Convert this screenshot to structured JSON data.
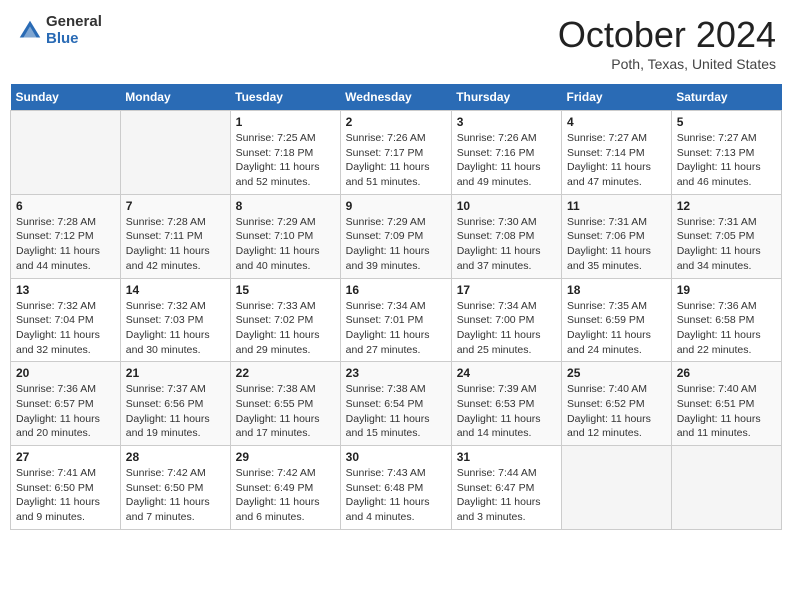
{
  "header": {
    "logo_general": "General",
    "logo_blue": "Blue",
    "month_title": "October 2024",
    "location": "Poth, Texas, United States"
  },
  "days_of_week": [
    "Sunday",
    "Monday",
    "Tuesday",
    "Wednesday",
    "Thursday",
    "Friday",
    "Saturday"
  ],
  "weeks": [
    [
      {
        "day": "",
        "empty": true
      },
      {
        "day": "",
        "empty": true
      },
      {
        "day": "1",
        "sunrise": "Sunrise: 7:25 AM",
        "sunset": "Sunset: 7:18 PM",
        "daylight": "Daylight: 11 hours and 52 minutes."
      },
      {
        "day": "2",
        "sunrise": "Sunrise: 7:26 AM",
        "sunset": "Sunset: 7:17 PM",
        "daylight": "Daylight: 11 hours and 51 minutes."
      },
      {
        "day": "3",
        "sunrise": "Sunrise: 7:26 AM",
        "sunset": "Sunset: 7:16 PM",
        "daylight": "Daylight: 11 hours and 49 minutes."
      },
      {
        "day": "4",
        "sunrise": "Sunrise: 7:27 AM",
        "sunset": "Sunset: 7:14 PM",
        "daylight": "Daylight: 11 hours and 47 minutes."
      },
      {
        "day": "5",
        "sunrise": "Sunrise: 7:27 AM",
        "sunset": "Sunset: 7:13 PM",
        "daylight": "Daylight: 11 hours and 46 minutes."
      }
    ],
    [
      {
        "day": "6",
        "sunrise": "Sunrise: 7:28 AM",
        "sunset": "Sunset: 7:12 PM",
        "daylight": "Daylight: 11 hours and 44 minutes."
      },
      {
        "day": "7",
        "sunrise": "Sunrise: 7:28 AM",
        "sunset": "Sunset: 7:11 PM",
        "daylight": "Daylight: 11 hours and 42 minutes."
      },
      {
        "day": "8",
        "sunrise": "Sunrise: 7:29 AM",
        "sunset": "Sunset: 7:10 PM",
        "daylight": "Daylight: 11 hours and 40 minutes."
      },
      {
        "day": "9",
        "sunrise": "Sunrise: 7:29 AM",
        "sunset": "Sunset: 7:09 PM",
        "daylight": "Daylight: 11 hours and 39 minutes."
      },
      {
        "day": "10",
        "sunrise": "Sunrise: 7:30 AM",
        "sunset": "Sunset: 7:08 PM",
        "daylight": "Daylight: 11 hours and 37 minutes."
      },
      {
        "day": "11",
        "sunrise": "Sunrise: 7:31 AM",
        "sunset": "Sunset: 7:06 PM",
        "daylight": "Daylight: 11 hours and 35 minutes."
      },
      {
        "day": "12",
        "sunrise": "Sunrise: 7:31 AM",
        "sunset": "Sunset: 7:05 PM",
        "daylight": "Daylight: 11 hours and 34 minutes."
      }
    ],
    [
      {
        "day": "13",
        "sunrise": "Sunrise: 7:32 AM",
        "sunset": "Sunset: 7:04 PM",
        "daylight": "Daylight: 11 hours and 32 minutes."
      },
      {
        "day": "14",
        "sunrise": "Sunrise: 7:32 AM",
        "sunset": "Sunset: 7:03 PM",
        "daylight": "Daylight: 11 hours and 30 minutes."
      },
      {
        "day": "15",
        "sunrise": "Sunrise: 7:33 AM",
        "sunset": "Sunset: 7:02 PM",
        "daylight": "Daylight: 11 hours and 29 minutes."
      },
      {
        "day": "16",
        "sunrise": "Sunrise: 7:34 AM",
        "sunset": "Sunset: 7:01 PM",
        "daylight": "Daylight: 11 hours and 27 minutes."
      },
      {
        "day": "17",
        "sunrise": "Sunrise: 7:34 AM",
        "sunset": "Sunset: 7:00 PM",
        "daylight": "Daylight: 11 hours and 25 minutes."
      },
      {
        "day": "18",
        "sunrise": "Sunrise: 7:35 AM",
        "sunset": "Sunset: 6:59 PM",
        "daylight": "Daylight: 11 hours and 24 minutes."
      },
      {
        "day": "19",
        "sunrise": "Sunrise: 7:36 AM",
        "sunset": "Sunset: 6:58 PM",
        "daylight": "Daylight: 11 hours and 22 minutes."
      }
    ],
    [
      {
        "day": "20",
        "sunrise": "Sunrise: 7:36 AM",
        "sunset": "Sunset: 6:57 PM",
        "daylight": "Daylight: 11 hours and 20 minutes."
      },
      {
        "day": "21",
        "sunrise": "Sunrise: 7:37 AM",
        "sunset": "Sunset: 6:56 PM",
        "daylight": "Daylight: 11 hours and 19 minutes."
      },
      {
        "day": "22",
        "sunrise": "Sunrise: 7:38 AM",
        "sunset": "Sunset: 6:55 PM",
        "daylight": "Daylight: 11 hours and 17 minutes."
      },
      {
        "day": "23",
        "sunrise": "Sunrise: 7:38 AM",
        "sunset": "Sunset: 6:54 PM",
        "daylight": "Daylight: 11 hours and 15 minutes."
      },
      {
        "day": "24",
        "sunrise": "Sunrise: 7:39 AM",
        "sunset": "Sunset: 6:53 PM",
        "daylight": "Daylight: 11 hours and 14 minutes."
      },
      {
        "day": "25",
        "sunrise": "Sunrise: 7:40 AM",
        "sunset": "Sunset: 6:52 PM",
        "daylight": "Daylight: 11 hours and 12 minutes."
      },
      {
        "day": "26",
        "sunrise": "Sunrise: 7:40 AM",
        "sunset": "Sunset: 6:51 PM",
        "daylight": "Daylight: 11 hours and 11 minutes."
      }
    ],
    [
      {
        "day": "27",
        "sunrise": "Sunrise: 7:41 AM",
        "sunset": "Sunset: 6:50 PM",
        "daylight": "Daylight: 11 hours and 9 minutes."
      },
      {
        "day": "28",
        "sunrise": "Sunrise: 7:42 AM",
        "sunset": "Sunset: 6:50 PM",
        "daylight": "Daylight: 11 hours and 7 minutes."
      },
      {
        "day": "29",
        "sunrise": "Sunrise: 7:42 AM",
        "sunset": "Sunset: 6:49 PM",
        "daylight": "Daylight: 11 hours and 6 minutes."
      },
      {
        "day": "30",
        "sunrise": "Sunrise: 7:43 AM",
        "sunset": "Sunset: 6:48 PM",
        "daylight": "Daylight: 11 hours and 4 minutes."
      },
      {
        "day": "31",
        "sunrise": "Sunrise: 7:44 AM",
        "sunset": "Sunset: 6:47 PM",
        "daylight": "Daylight: 11 hours and 3 minutes."
      },
      {
        "day": "",
        "empty": true
      },
      {
        "day": "",
        "empty": true
      }
    ]
  ]
}
